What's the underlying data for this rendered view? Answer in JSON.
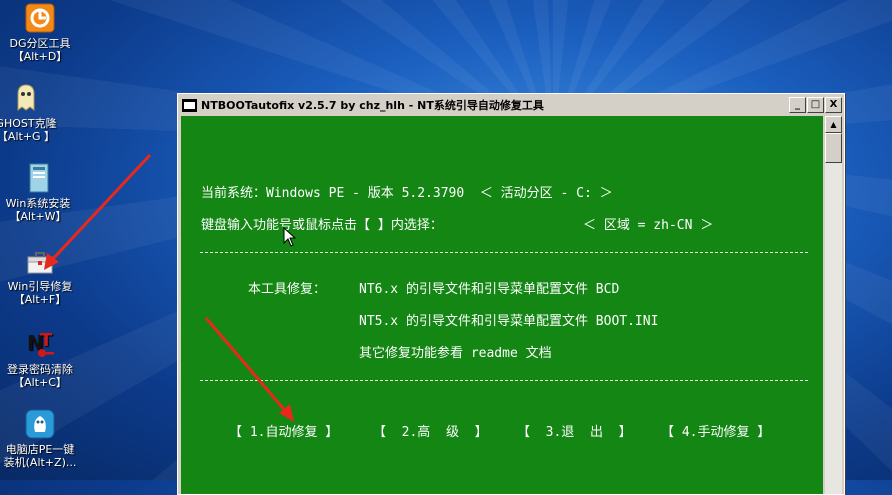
{
  "desktop": {
    "icons": [
      {
        "name": "diskgenius",
        "line1": "DG分区工具",
        "line2": "【Alt+D】"
      },
      {
        "name": "ghost",
        "line1": "GHOST克隆",
        "line2": "【Alt+G 】"
      },
      {
        "name": "win-install",
        "line1": "Win系统安装",
        "line2": "【Alt+W】"
      },
      {
        "name": "win-boot-repair",
        "line1": "Win引导修复",
        "line2": "【Alt+F】"
      },
      {
        "name": "password-clear",
        "line1": "登录密码清除",
        "line2": "【Alt+C】"
      },
      {
        "name": "pe-install",
        "line1": "电脑店PE一键",
        "line2": "装机(Alt+Z)..."
      }
    ]
  },
  "window": {
    "title": "NTBOOTautofix v2.5.7 by chz_hlh - NT系统引导自动修复工具",
    "buttons": {
      "minimize": "_",
      "maximize": "□",
      "close": "X"
    }
  },
  "console": {
    "current_system": "当前系统：Windows PE - 版本 5.2.3790  ＜ 活动分区 - C: ＞",
    "prompt": "键盘输入功能号或鼠标点击【 】内选择：",
    "region": "＜ 区域 = zh-CN ＞",
    "repair_label": "本工具修复：",
    "nt6_line": "NT6.x 的引导文件和引导菜单配置文件 BCD",
    "nt5_line": "NT5.x 的引导文件和引导菜单配置文件 BOOT.INI",
    "other_line": "其它修复功能参看 readme 文档",
    "menu": [
      "【 1.自动修复 】",
      "【  2.高  级  】",
      "【  3.退  出  】",
      "【 4.手动修复 】"
    ]
  },
  "colors": {
    "console_bg": "#138613",
    "annotation_arrow": "#e8281c"
  }
}
